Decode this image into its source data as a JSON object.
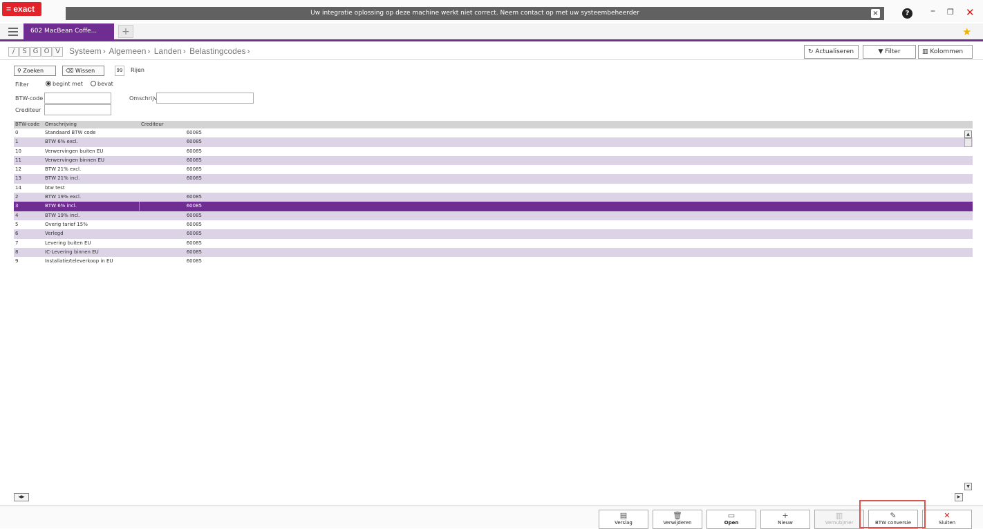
{
  "app": {
    "logo_text": "= exact",
    "message": "Uw integratie oplossing op deze machine werkt niet correct. Neem contact op met uw systeembeheerder"
  },
  "tabs": {
    "active_label": "602 MacBean Coffe...",
    "add_label": "+"
  },
  "nav": {
    "letters": [
      "/",
      "S",
      "G",
      "O",
      "V"
    ],
    "breadcrumb": [
      "Systeem",
      "Algemeen",
      "Landen",
      "Belastingcodes"
    ],
    "refresh_label": "Actualiseren",
    "filter_label": "Filter",
    "columns_label": "Kolommen"
  },
  "toolbar": {
    "search_label": "Zoeken",
    "clear_label": "Wissen",
    "rows_count": "99",
    "rows_label": "Rijen"
  },
  "filter": {
    "label": "Filter",
    "option_begins": "begint met",
    "option_contains": "bevat",
    "vat_code_label": "BTW-code",
    "description_label": "Omschrijving",
    "creditor_label": "Crediteur",
    "vat_code_value": "",
    "description_value": "",
    "creditor_value": ""
  },
  "table": {
    "headers": [
      "BTW-code",
      "Omschrijving",
      "Crediteur"
    ],
    "rows": [
      {
        "code": "0",
        "desc": "Standaard BTW code",
        "cred": "60085"
      },
      {
        "code": "1",
        "desc": "BTW 6% excl.",
        "cred": "60085"
      },
      {
        "code": "10",
        "desc": "Verwervingen buiten EU",
        "cred": "60085"
      },
      {
        "code": "11",
        "desc": "Verwervingen binnen EU",
        "cred": "60085"
      },
      {
        "code": "12",
        "desc": "BTW 21% excl.",
        "cred": "60085"
      },
      {
        "code": "13",
        "desc": "BTW 21% incl.",
        "cred": "60085"
      },
      {
        "code": "14",
        "desc": "btw test",
        "cred": ""
      },
      {
        "code": "2",
        "desc": "BTW 19% excl.",
        "cred": "60085"
      },
      {
        "code": "3",
        "desc": "BTW 6% incl.",
        "cred": "60085"
      },
      {
        "code": "4",
        "desc": "BTW 19% incl.",
        "cred": "60085"
      },
      {
        "code": "5",
        "desc": "Overig tarief 15%",
        "cred": "60085"
      },
      {
        "code": "6",
        "desc": "Verlegd",
        "cred": "60085"
      },
      {
        "code": "7",
        "desc": "Levering buiten EU",
        "cred": "60085"
      },
      {
        "code": "8",
        "desc": "IC-Levering binnen EU",
        "cred": "60085"
      },
      {
        "code": "9",
        "desc": "Installatie/televerkoop in EU",
        "cred": "60085"
      }
    ],
    "selected_index": 8
  },
  "actions": {
    "report": "Verslag",
    "delete": "Verwijderen",
    "open": "Open",
    "new": "Nieuw",
    "import": "Vernubjmer",
    "convert": "BTW conversie",
    "close": "Sluiten"
  },
  "colors": {
    "accent": "#6f2c91",
    "alt_row": "#ddd3e7",
    "logo": "#e4222a",
    "highlight": "#d9534f"
  }
}
